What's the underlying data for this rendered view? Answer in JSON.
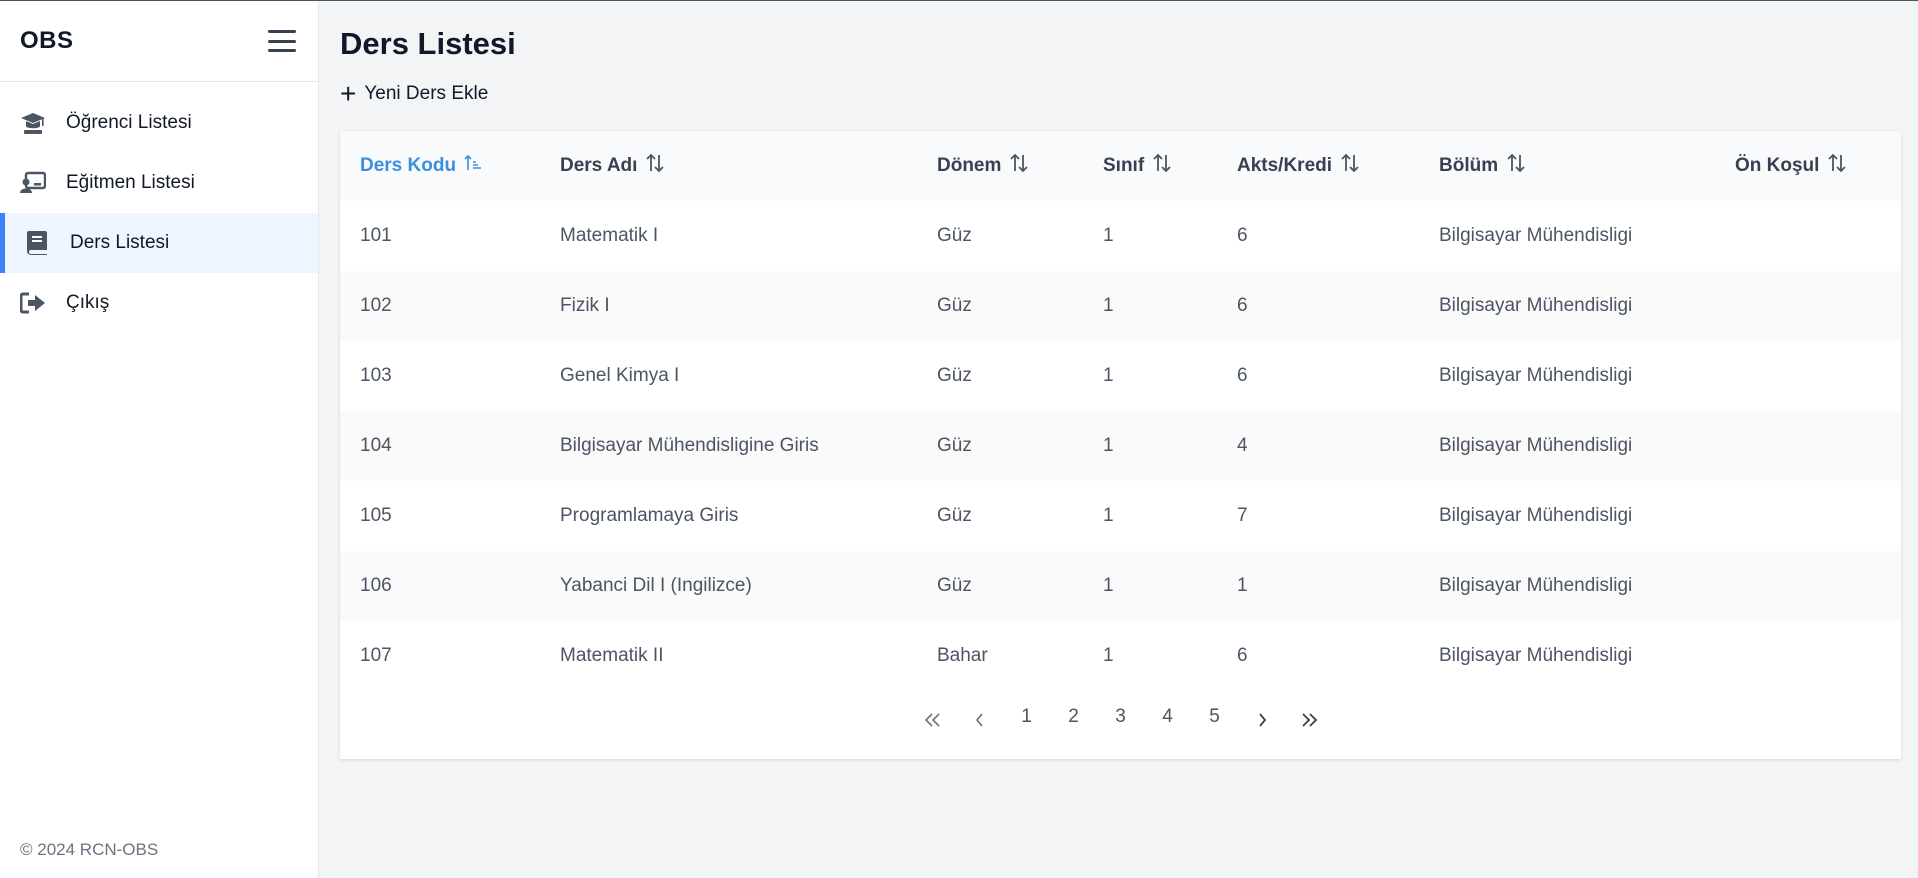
{
  "app": {
    "brand": "OBS",
    "copyright": "© 2024 RCN-OBS"
  },
  "sidebar": {
    "items": [
      {
        "label": "Öğrenci Listesi",
        "icon": "graduation-cap-icon"
      },
      {
        "label": "Eğitmen Listesi",
        "icon": "chalkboard-teacher-icon"
      },
      {
        "label": "Ders Listesi",
        "icon": "book-icon",
        "active": true
      },
      {
        "label": "Çıkış",
        "icon": "sign-out-icon"
      }
    ]
  },
  "main": {
    "title": "Ders Listesi",
    "add_label": "Yeni Ders Ekle"
  },
  "table": {
    "columns": [
      "Ders Kodu",
      "Ders Adı",
      "Dönem",
      "Sınıf",
      "Akts/Kredi",
      "Bölüm",
      "Ön Koşul"
    ],
    "sorted_column": "Ders Kodu",
    "rows": [
      [
        "101",
        "Matematik I",
        "Güz",
        "1",
        "6",
        "Bilgisayar Mühendisligi",
        ""
      ],
      [
        "102",
        "Fizik I",
        "Güz",
        "1",
        "6",
        "Bilgisayar Mühendisligi",
        ""
      ],
      [
        "103",
        "Genel Kimya I",
        "Güz",
        "1",
        "6",
        "Bilgisayar Mühendisligi",
        ""
      ],
      [
        "104",
        "Bilgisayar Mühendisligine Giris",
        "Güz",
        "1",
        "4",
        "Bilgisayar Mühendisligi",
        ""
      ],
      [
        "105",
        "Programlamaya Giris",
        "Güz",
        "1",
        "7",
        "Bilgisayar Mühendisligi",
        ""
      ],
      [
        "106",
        "Yabanci Dil I (Ingilizce)",
        "Güz",
        "1",
        "1",
        "Bilgisayar Mühendisligi",
        ""
      ],
      [
        "107",
        "Matematik II",
        "Bahar",
        "1",
        "6",
        "Bilgisayar Mühendisligi",
        ""
      ]
    ]
  },
  "pagination": {
    "first": "«",
    "prev": "‹",
    "pages": [
      "1",
      "2",
      "3",
      "4",
      "5"
    ],
    "next": "›",
    "last": "»"
  },
  "colors": {
    "accent": "#3b8fe0",
    "active_bg": "#eff6ff",
    "active_bar": "#3b82f6"
  }
}
